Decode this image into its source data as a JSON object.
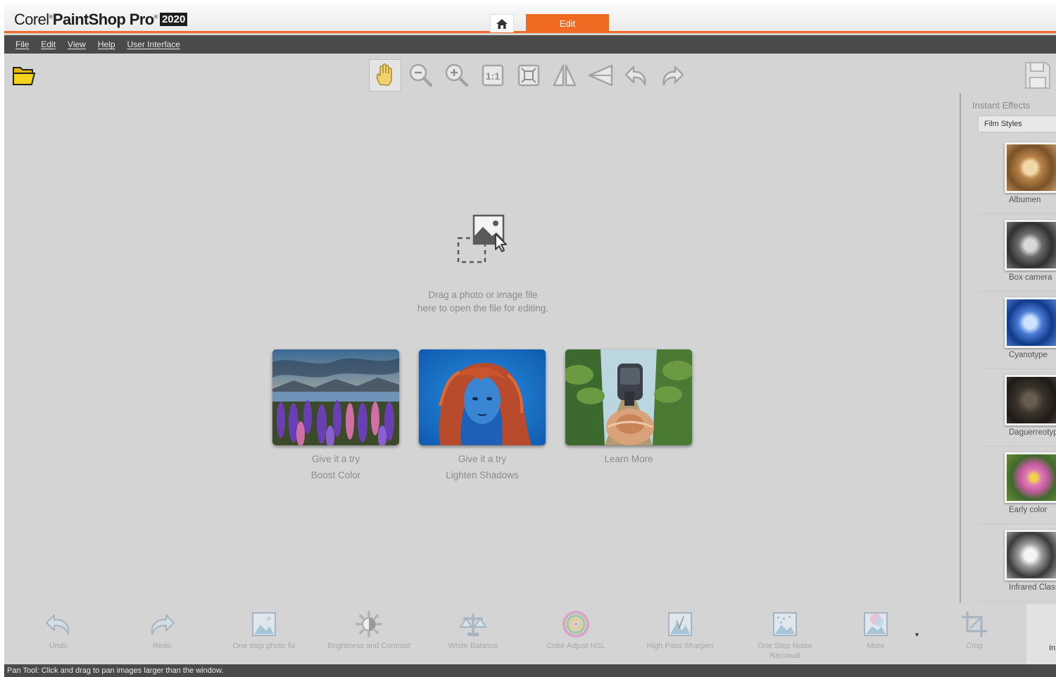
{
  "app": {
    "logo_brand": "Corel",
    "logo_product": "PaintShop Pro",
    "logo_year": "2020",
    "accent_color": "#f06a22"
  },
  "tabs": {
    "home_icon": "home-icon",
    "edit_label": "Edit"
  },
  "menu": [
    "File",
    "Edit",
    "View",
    "Help",
    "User Interface"
  ],
  "toolbar": {
    "tools": [
      "pan-icon",
      "zoom-out-icon",
      "zoom-in-icon",
      "actual-size-icon",
      "fit-to-window-icon",
      "flip-horizontal-icon",
      "flip-vertical-icon",
      "undo-icon",
      "redo-icon"
    ],
    "active_tool": "pan-icon"
  },
  "drop": {
    "line1": "Drag a photo or image file",
    "line2": "here to open the file for editing."
  },
  "cards": [
    {
      "line1": "Give it a try",
      "line2": "Boost Color"
    },
    {
      "line1": "Give it a try",
      "line2": "Lighten Shadows"
    },
    {
      "line1": "Learn More",
      "line2": ""
    }
  ],
  "instant_effects": {
    "title": "Instant Effects",
    "category": "Film Styles",
    "items": [
      "Albumen",
      "Box camera",
      "Cyanotype",
      "Daguerreotype",
      "Early color",
      "Infrared Classic"
    ]
  },
  "bottom_tools": [
    {
      "icon": "undo-icon",
      "label": "Undo"
    },
    {
      "icon": "redo-icon",
      "label": "Redo"
    },
    {
      "icon": "one-step-photo-fix-icon",
      "label": "One step photo fix"
    },
    {
      "icon": "brightness-contrast-icon",
      "label": "Brightness and Contrast"
    },
    {
      "icon": "white-balance-icon",
      "label": "White Balance"
    },
    {
      "icon": "color-adjust-hsl-icon",
      "label": "Color Adjust HSL"
    },
    {
      "icon": "high-pass-sharpen-icon",
      "label": "High Pass Sharpen"
    },
    {
      "icon": "noise-removal-icon",
      "label": "One Step Noise Removal"
    },
    {
      "icon": "more-icon",
      "label": "More"
    },
    {
      "icon": "crop-icon",
      "label": "Crop"
    }
  ],
  "bottom_right_label": "In",
  "status": "Pan Tool: Click and drag to pan images larger than the window."
}
